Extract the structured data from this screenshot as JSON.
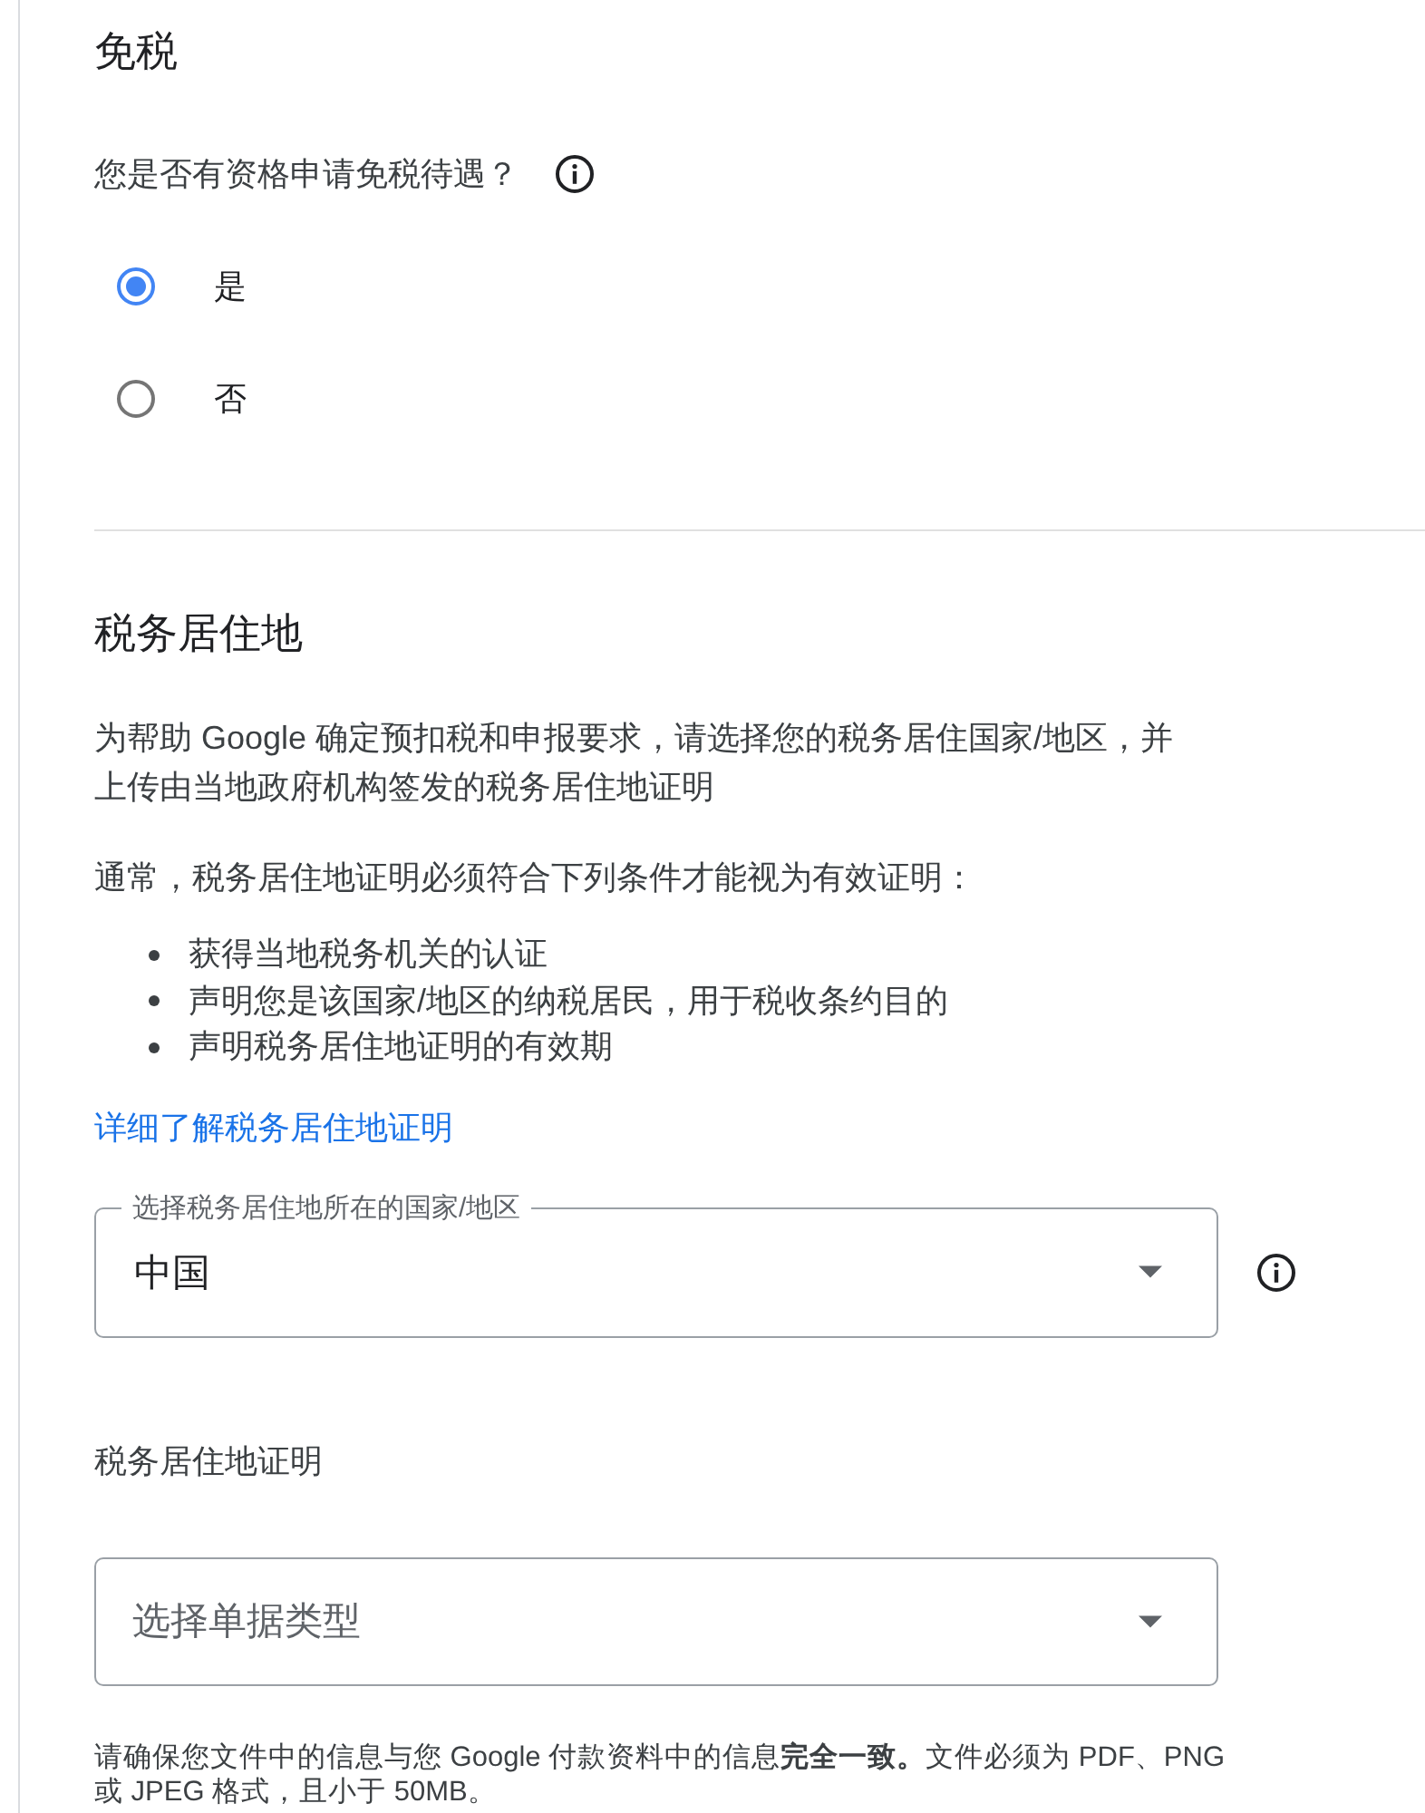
{
  "exemption": {
    "title": "免税",
    "question": "您是否有资格申请免税待遇？",
    "options": [
      {
        "label": "是",
        "selected": true
      },
      {
        "label": "否",
        "selected": false
      }
    ]
  },
  "residency": {
    "title": "税务居住地",
    "intro": "为帮助 Google 确定预扣税和申报要求，请选择您的税务居住国家/地区，并上传由当地政府机构签发的税务居住地证明",
    "conditions_intro": "通常，税务居住地证明必须符合下列条件才能视为有效证明：",
    "conditions": [
      "获得当地税务机关的认证",
      "声明您是该国家/地区的纳税居民，用于税收条约目的",
      "声明税务居住地证明的有效期"
    ],
    "link": "详细了解税务居住地证明",
    "country_select": {
      "label": "选择税务居住地所在的国家/地区",
      "value": "中国"
    },
    "certificate_label": "税务居住地证明",
    "document_select": {
      "placeholder": "选择单据类型"
    },
    "note": "请确保您文件中的信息与您 Google 付款资料中的信息**完全一致。**文件必须为 PDF、PNG 或 JPEG 格式，且小于 50MB。"
  }
}
